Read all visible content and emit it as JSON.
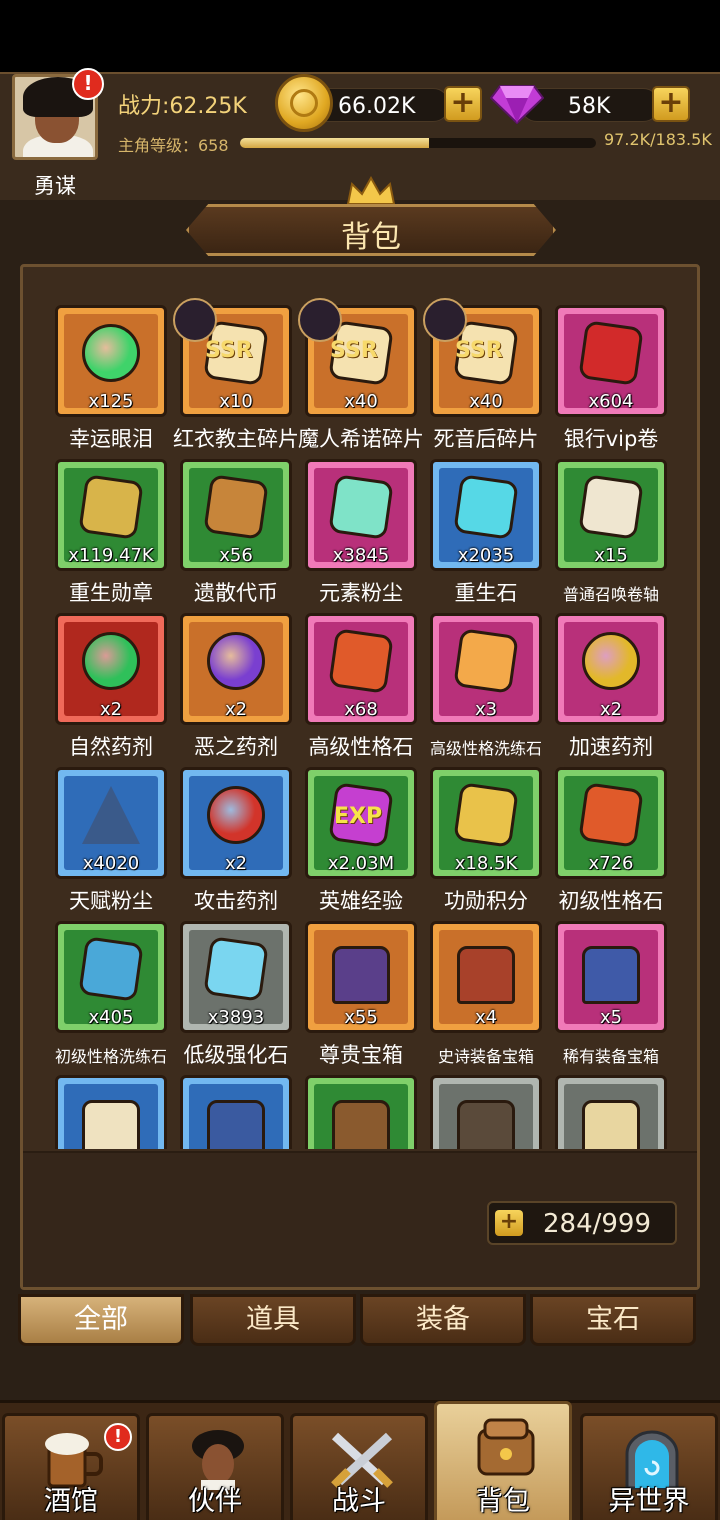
{
  "header": {
    "player_name": "勇谋",
    "power": "战力:62.25K",
    "gold": "66.02K",
    "gems": "58K",
    "level_label": "主角等级：658",
    "xp_text": "97.2K/183.5K",
    "xp_progress": 0.53,
    "add_symbol": "+",
    "alert_symbol": "!"
  },
  "title": "背包",
  "items": [
    {
      "name": "幸运眼泪",
      "count": "x125",
      "rarity": "orange",
      "icon": "green-droplet-icon"
    },
    {
      "name": "红衣教主碎片",
      "count": "x10",
      "rarity": "orange",
      "icon": "ssr-fragment-icon",
      "ssr": "SSR"
    },
    {
      "name": "魔人希诺碎片",
      "count": "x40",
      "rarity": "orange",
      "icon": "ssr-fragment-icon",
      "ssr": "SSR"
    },
    {
      "name": "死音后碎片",
      "count": "x40",
      "rarity": "orange",
      "icon": "ssr-fragment-icon",
      "ssr": "SSR"
    },
    {
      "name": "银行vip卷",
      "count": "x604",
      "rarity": "pink",
      "icon": "vip-ticket-icon"
    },
    {
      "name": "重生勋章",
      "count": "x119.47K",
      "rarity": "green",
      "icon": "medal-icon"
    },
    {
      "name": "遗散代币",
      "count": "x56",
      "rarity": "green",
      "icon": "token-icon"
    },
    {
      "name": "元素粉尘",
      "count": "x3845",
      "rarity": "pink",
      "icon": "potion-bottle-icon"
    },
    {
      "name": "重生石",
      "count": "x2035",
      "rarity": "blue",
      "icon": "rune-stone-icon"
    },
    {
      "name": "普通召唤卷轴",
      "count": "x15",
      "rarity": "green",
      "icon": "scroll-icon",
      "small": true
    },
    {
      "name": "自然药剂",
      "count": "x2",
      "rarity": "red",
      "icon": "green-flask-icon"
    },
    {
      "name": "恶之药剂",
      "count": "x2",
      "rarity": "orange",
      "icon": "purple-flask-icon"
    },
    {
      "name": "高级性格石",
      "count": "x68",
      "rarity": "pink",
      "icon": "trait-stone-icon"
    },
    {
      "name": "高级性格洗练石",
      "count": "x3",
      "rarity": "pink",
      "icon": "crystal-icon",
      "small": true
    },
    {
      "name": "加速药剂",
      "count": "x2",
      "rarity": "pink",
      "icon": "yellow-flask-icon"
    },
    {
      "name": "天赋粉尘",
      "count": "x4020",
      "rarity": "blue",
      "icon": "dust-pile-icon"
    },
    {
      "name": "攻击药剂",
      "count": "x2",
      "rarity": "blue",
      "icon": "red-flask-icon"
    },
    {
      "name": "英雄经验",
      "count": "x2.03M",
      "rarity": "green",
      "icon": "exp-icon",
      "exp": "EXP"
    },
    {
      "name": "功勋积分",
      "count": "x18.5K",
      "rarity": "green",
      "icon": "honor-badge-icon"
    },
    {
      "name": "初级性格石",
      "count": "x726",
      "rarity": "green",
      "icon": "trait-stone-icon"
    },
    {
      "name": "初级性格洗练石",
      "count": "x405",
      "rarity": "green",
      "icon": "blue-crystal-icon",
      "small": true
    },
    {
      "name": "低级强化石",
      "count": "x3893",
      "rarity": "gray",
      "icon": "ice-crystal-icon"
    },
    {
      "name": "尊贵宝箱",
      "count": "x55",
      "rarity": "orange",
      "icon": "noble-chest-icon"
    },
    {
      "name": "史诗装备宝箱",
      "count": "x4",
      "rarity": "orange",
      "icon": "epic-chest-icon",
      "small": true
    },
    {
      "name": "稀有装备宝箱",
      "count": "x5",
      "rarity": "pink",
      "icon": "rare-chest-icon",
      "small": true
    },
    {
      "name": "",
      "count": "",
      "rarity": "blue",
      "icon": "white-chest-icon"
    },
    {
      "name": "",
      "count": "",
      "rarity": "blue",
      "icon": "blue-chest-icon"
    },
    {
      "name": "",
      "count": "",
      "rarity": "green",
      "icon": "wood-chest-icon"
    },
    {
      "name": "",
      "count": "",
      "rarity": "gray",
      "icon": "iron-chest-icon"
    },
    {
      "name": "",
      "count": "",
      "rarity": "gray",
      "icon": "gold-chest-icon"
    }
  ],
  "capacity": "284/999",
  "tabs": [
    "全部",
    "道具",
    "装备",
    "宝石"
  ],
  "active_tab": "全部",
  "nav": [
    "酒馆",
    "伙伴",
    "战斗",
    "背包",
    "异世界"
  ],
  "active_nav": "背包",
  "colors": {
    "orange": "#c9702a",
    "pink": "#b8307a",
    "green": "#2f8a34",
    "blue": "#2f6cb8",
    "gray": "#6c726c",
    "red": "#b0281e"
  }
}
